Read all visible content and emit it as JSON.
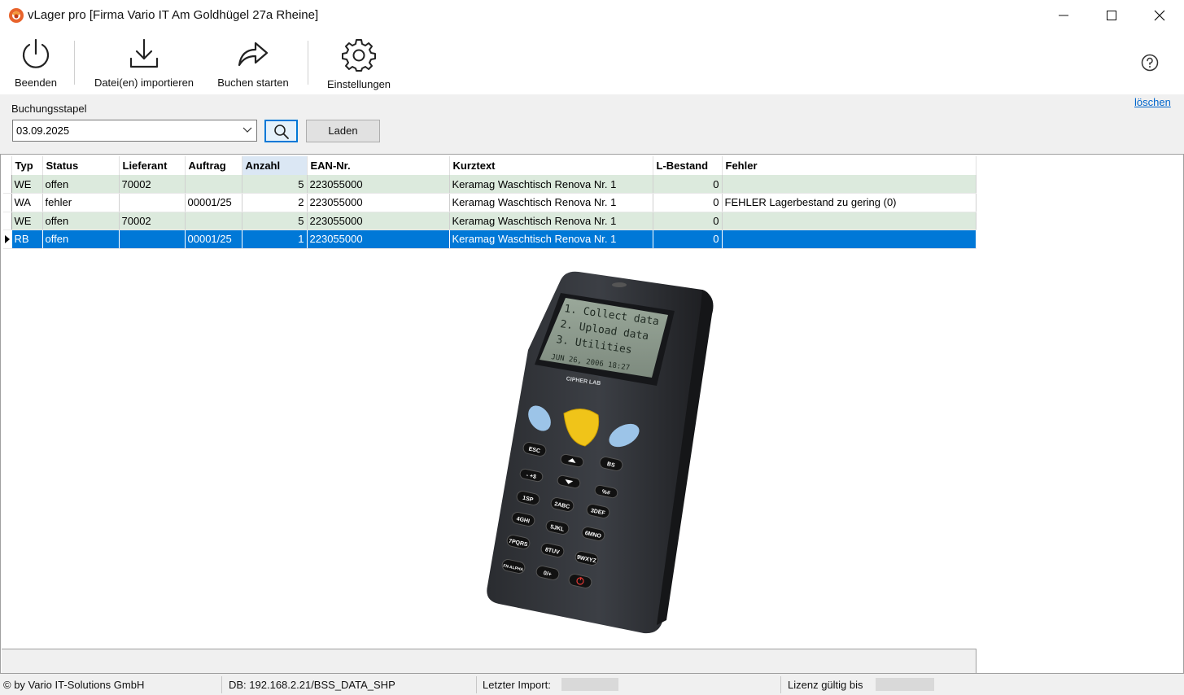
{
  "window": {
    "title": "vLager pro [Firma Vario IT Am Goldhügel 27a Rheine]",
    "icon": "vario-logo-icon",
    "controls": [
      "minimize-icon",
      "maximize-icon",
      "close-icon"
    ]
  },
  "toolbar": {
    "beenden": {
      "label": "Beenden",
      "icon": "power-icon"
    },
    "import": {
      "label": "Datei(en) importieren",
      "icon": "download-icon"
    },
    "buchen": {
      "label": "Buchen starten",
      "icon": "share-arrow-icon"
    },
    "settings": {
      "label": "Einstellungen",
      "icon": "gear-icon"
    },
    "help_icon": "help-icon"
  },
  "filter": {
    "label": "Buchungsstapel",
    "date_value": "03.09.2025",
    "load_label": "Laden",
    "clear_label": "löschen"
  },
  "grid": {
    "columns": [
      "Typ",
      "Status",
      "Lieferant",
      "Auftrag",
      "Anzahl",
      "EAN-Nr.",
      "Kurztext",
      "L-Bestand",
      "Fehler"
    ],
    "sorted_column": "Anzahl",
    "rows": [
      {
        "typ": "WE",
        "status": "offen",
        "lieferant": "70002",
        "auftrag": "",
        "anzahl": "5",
        "ean": "223055000",
        "kurztext": "Keramag Waschtisch Renova Nr. 1",
        "bestand": "0",
        "fehler": ""
      },
      {
        "typ": "WA",
        "status": "fehler",
        "lieferant": "",
        "auftrag": "00001/25",
        "anzahl": "2",
        "ean": "223055000",
        "kurztext": "Keramag Waschtisch Renova Nr. 1",
        "bestand": "0",
        "fehler": "FEHLER Lagerbestand zu gering (0)"
      },
      {
        "typ": "WE",
        "status": "offen",
        "lieferant": "70002",
        "auftrag": "",
        "anzahl": "5",
        "ean": "223055000",
        "kurztext": "Keramag Waschtisch Renova Nr. 1",
        "bestand": "0",
        "fehler": ""
      },
      {
        "typ": "RB",
        "status": "offen",
        "lieferant": "",
        "auftrag": "00001/25",
        "anzahl": "1",
        "ean": "223055000",
        "kurztext": "Keramag Waschtisch Renova Nr. 1",
        "bestand": "0",
        "fehler": ""
      }
    ],
    "selected_row": 3
  },
  "device_image": {
    "screen_lines": [
      "1. Collect data",
      "2. Upload data",
      "3. Utilities"
    ],
    "screen_date": "JUN 26, 2006 18:27",
    "brand": "CIPHER LAB",
    "keys": [
      "ESC",
      "BS",
      "- +$",
      "%#",
      "1SP",
      "2ABC",
      "3DEF",
      "4GHI",
      "5JKL",
      "6MNO",
      "7PQRS",
      "8TUV",
      "9WXYZ",
      "FN ALPHA",
      "0/+"
    ]
  },
  "status": {
    "copyright": "© by Vario IT-Solutions GmbH",
    "db": "DB: 192.168.2.21/BSS_DATA_SHP",
    "last_import": "Letzter Import:",
    "license": "Lizenz gültig bis"
  }
}
